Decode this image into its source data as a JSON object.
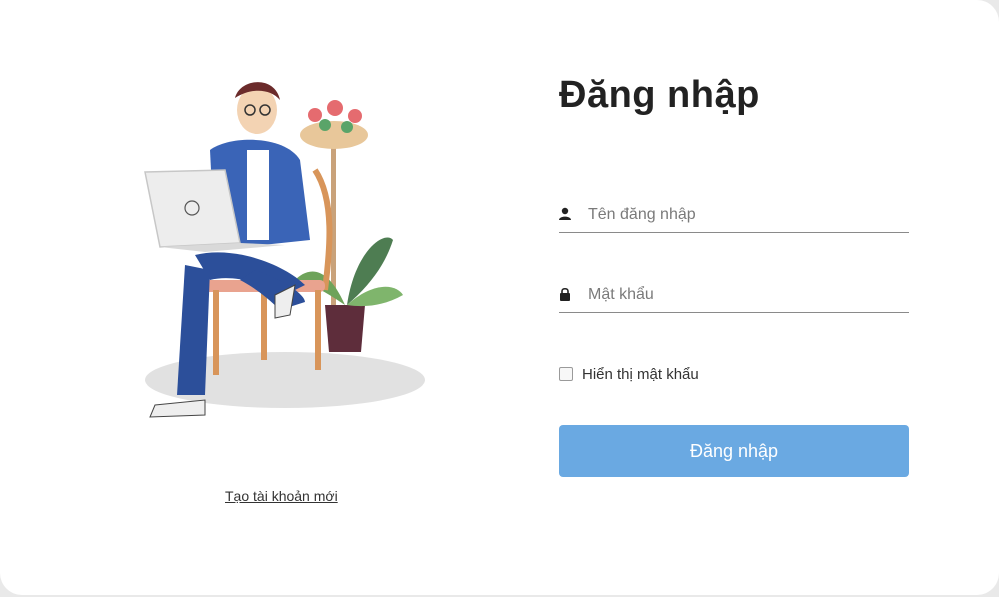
{
  "login": {
    "title": "Đăng nhập",
    "username_placeholder": "Tên đăng nhập",
    "password_placeholder": "Mật khẩu",
    "show_password_label": "Hiển thị mật khẩu",
    "submit_label": "Đăng nhập"
  },
  "signup": {
    "link_label": "Tạo tài khoản mới"
  },
  "icons": {
    "username": "user-icon",
    "password": "lock-icon"
  },
  "colors": {
    "button": "#6aa9e2",
    "text": "#222222"
  }
}
